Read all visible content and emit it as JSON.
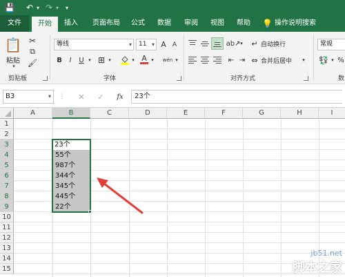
{
  "qat": {
    "save": "💾",
    "undo": "↶",
    "redo": "↷",
    "more": "▾"
  },
  "tabs": [
    {
      "label": "文件"
    },
    {
      "label": "开始"
    },
    {
      "label": "插入"
    },
    {
      "label": "页面布局"
    },
    {
      "label": "公式"
    },
    {
      "label": "数据"
    },
    {
      "label": "审阅"
    },
    {
      "label": "视图"
    },
    {
      "label": "帮助"
    },
    {
      "label": "操作说明搜索"
    }
  ],
  "tell_me_icon": "lightbulb-icon",
  "ribbon": {
    "clipboard": {
      "paste_label": "粘贴",
      "group_label": "剪贴板"
    },
    "font": {
      "name": "等线",
      "size": "11",
      "grow": "A",
      "shrink": "A",
      "bold": "B",
      "italic": "I",
      "underline": "U",
      "font_color_glyph": "A",
      "phonetic": "wén",
      "group_label": "字体"
    },
    "alignment": {
      "wrap_text": "自动换行",
      "merge_center": "合并后居中",
      "group_label": "对齐方式"
    },
    "number": {
      "format": "常规",
      "percent": "%",
      "partial_label": "数"
    }
  },
  "formula_bar": {
    "name_box": "B3",
    "cancel": "✕",
    "enter": "✓",
    "fx": "fx",
    "content": "23个"
  },
  "grid": {
    "columns": [
      "A",
      "B",
      "C",
      "D",
      "E",
      "F",
      "G",
      "H",
      "I"
    ],
    "rows": [
      "1",
      "2",
      "3",
      "4",
      "5",
      "6",
      "7",
      "8",
      "9",
      "10",
      "11",
      "12",
      "13",
      "14",
      "15"
    ],
    "b_values": [
      {
        "row": "3",
        "value": "23个"
      },
      {
        "row": "4",
        "value": "55个"
      },
      {
        "row": "5",
        "value": "987个"
      },
      {
        "row": "6",
        "value": "344个"
      },
      {
        "row": "7",
        "value": "345个"
      },
      {
        "row": "8",
        "value": "445个"
      },
      {
        "row": "9",
        "value": "22个"
      }
    ],
    "selected_column": "B",
    "selected_rows": [
      "3",
      "4",
      "5",
      "6",
      "7",
      "8",
      "9"
    ]
  },
  "watermark": {
    "site": "jb51.net",
    "name": "脚本之家"
  },
  "colors": {
    "accent": "#217346",
    "selection": "#c6c6c6",
    "arrow": "#e0403a"
  }
}
